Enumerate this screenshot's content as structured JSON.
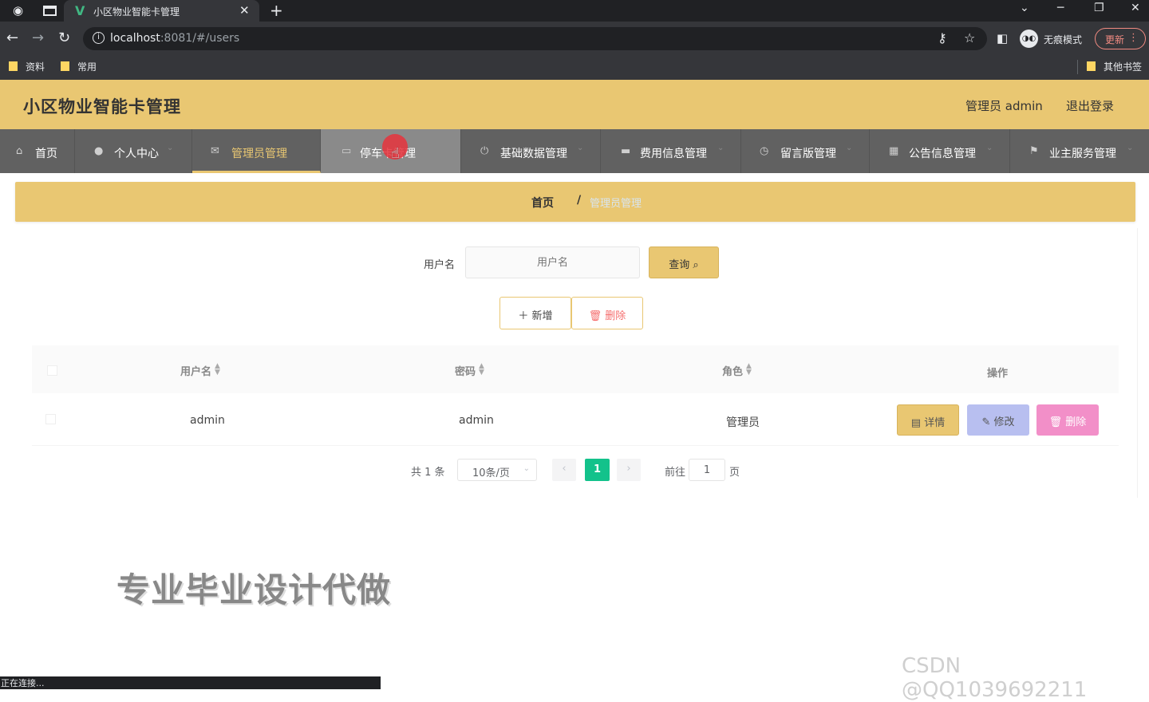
{
  "browser": {
    "tab_title": "小区物业智能卡管理",
    "tab_logo": "V",
    "url_host": "localhost",
    "url_rest": ":8081/#/users",
    "incognito_label": "无痕模式",
    "update_label": "更新",
    "bookmarks": [
      "资料",
      "常用"
    ],
    "other_bookmarks": "其他书签",
    "status_text": "正在连接..."
  },
  "header": {
    "title": "小区物业智能卡管理",
    "user": "管理员 admin",
    "logout": "退出登录"
  },
  "nav": [
    {
      "label": "首页",
      "icon": "home-icon",
      "glyph": "⌂"
    },
    {
      "label": "个人中心",
      "icon": "user-icon",
      "glyph": "●"
    },
    {
      "label": "管理员管理",
      "icon": "mail-icon",
      "glyph": "✉"
    },
    {
      "label": "停车卡管理",
      "icon": "card-icon",
      "glyph": "▭"
    },
    {
      "label": "基础数据管理",
      "icon": "power-icon",
      "glyph": "⏻"
    },
    {
      "label": "费用信息管理",
      "icon": "wallet-icon",
      "glyph": "▬"
    },
    {
      "label": "留言版管理",
      "icon": "clock-icon",
      "glyph": "◷"
    },
    {
      "label": "公告信息管理",
      "icon": "grid-icon",
      "glyph": "▦"
    },
    {
      "label": "业主服务管理",
      "icon": "flag-icon",
      "glyph": "⚑"
    }
  ],
  "breadcrumb": {
    "home": "首页",
    "separator": "/",
    "current": "管理员管理"
  },
  "search": {
    "label": "用户名",
    "placeholder": "用户名",
    "query_button": "查询 ⌕"
  },
  "actions": {
    "add": "＋ 新增",
    "delete": "🗑 删除"
  },
  "table": {
    "columns": [
      "用户名",
      "密码",
      "角色",
      "操作"
    ],
    "rows": [
      {
        "username": "admin",
        "password": "admin",
        "role": "管理员"
      }
    ],
    "row_buttons": {
      "detail": "▤ 详情",
      "edit": "✎ 修改",
      "delete": "🗑 删除"
    }
  },
  "pagination": {
    "total": "共 1 条",
    "page_size": "10条/页",
    "current_page": "1",
    "goto_label": "前往",
    "goto_value": "1",
    "page_suffix": "页"
  },
  "overlay": {
    "watermark": "专业毕业设计代做",
    "csdn": "CSDN @QQ1039692211"
  },
  "colors": {
    "accent": "#e9c772",
    "nav_bg": "#616161",
    "page_active": "#13c28b",
    "edit_btn": "#b8bff0",
    "delete_btn": "#f28fc8"
  }
}
